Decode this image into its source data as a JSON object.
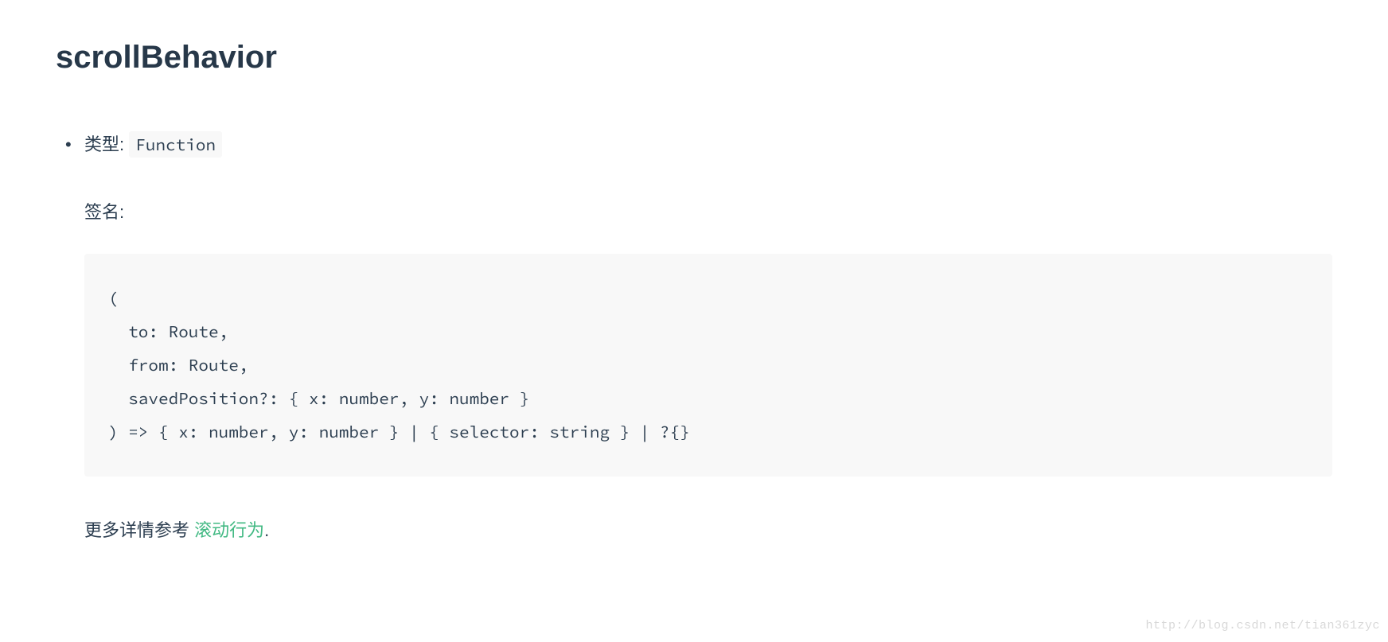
{
  "heading": "scrollBehavior",
  "type_label": "类型: ",
  "type_value": "Function",
  "signature_label": "签名:",
  "code_block": "(\n  to: Route,\n  from: Route,\n  savedPosition?: { x: number, y: number }\n) => { x: number, y: number } | { selector: string } | ?{}",
  "more_info_prefix": "更多详情参考 ",
  "more_info_link": "滚动行为",
  "more_info_suffix": ".",
  "watermark": "http://blog.csdn.net/tian361zyc"
}
